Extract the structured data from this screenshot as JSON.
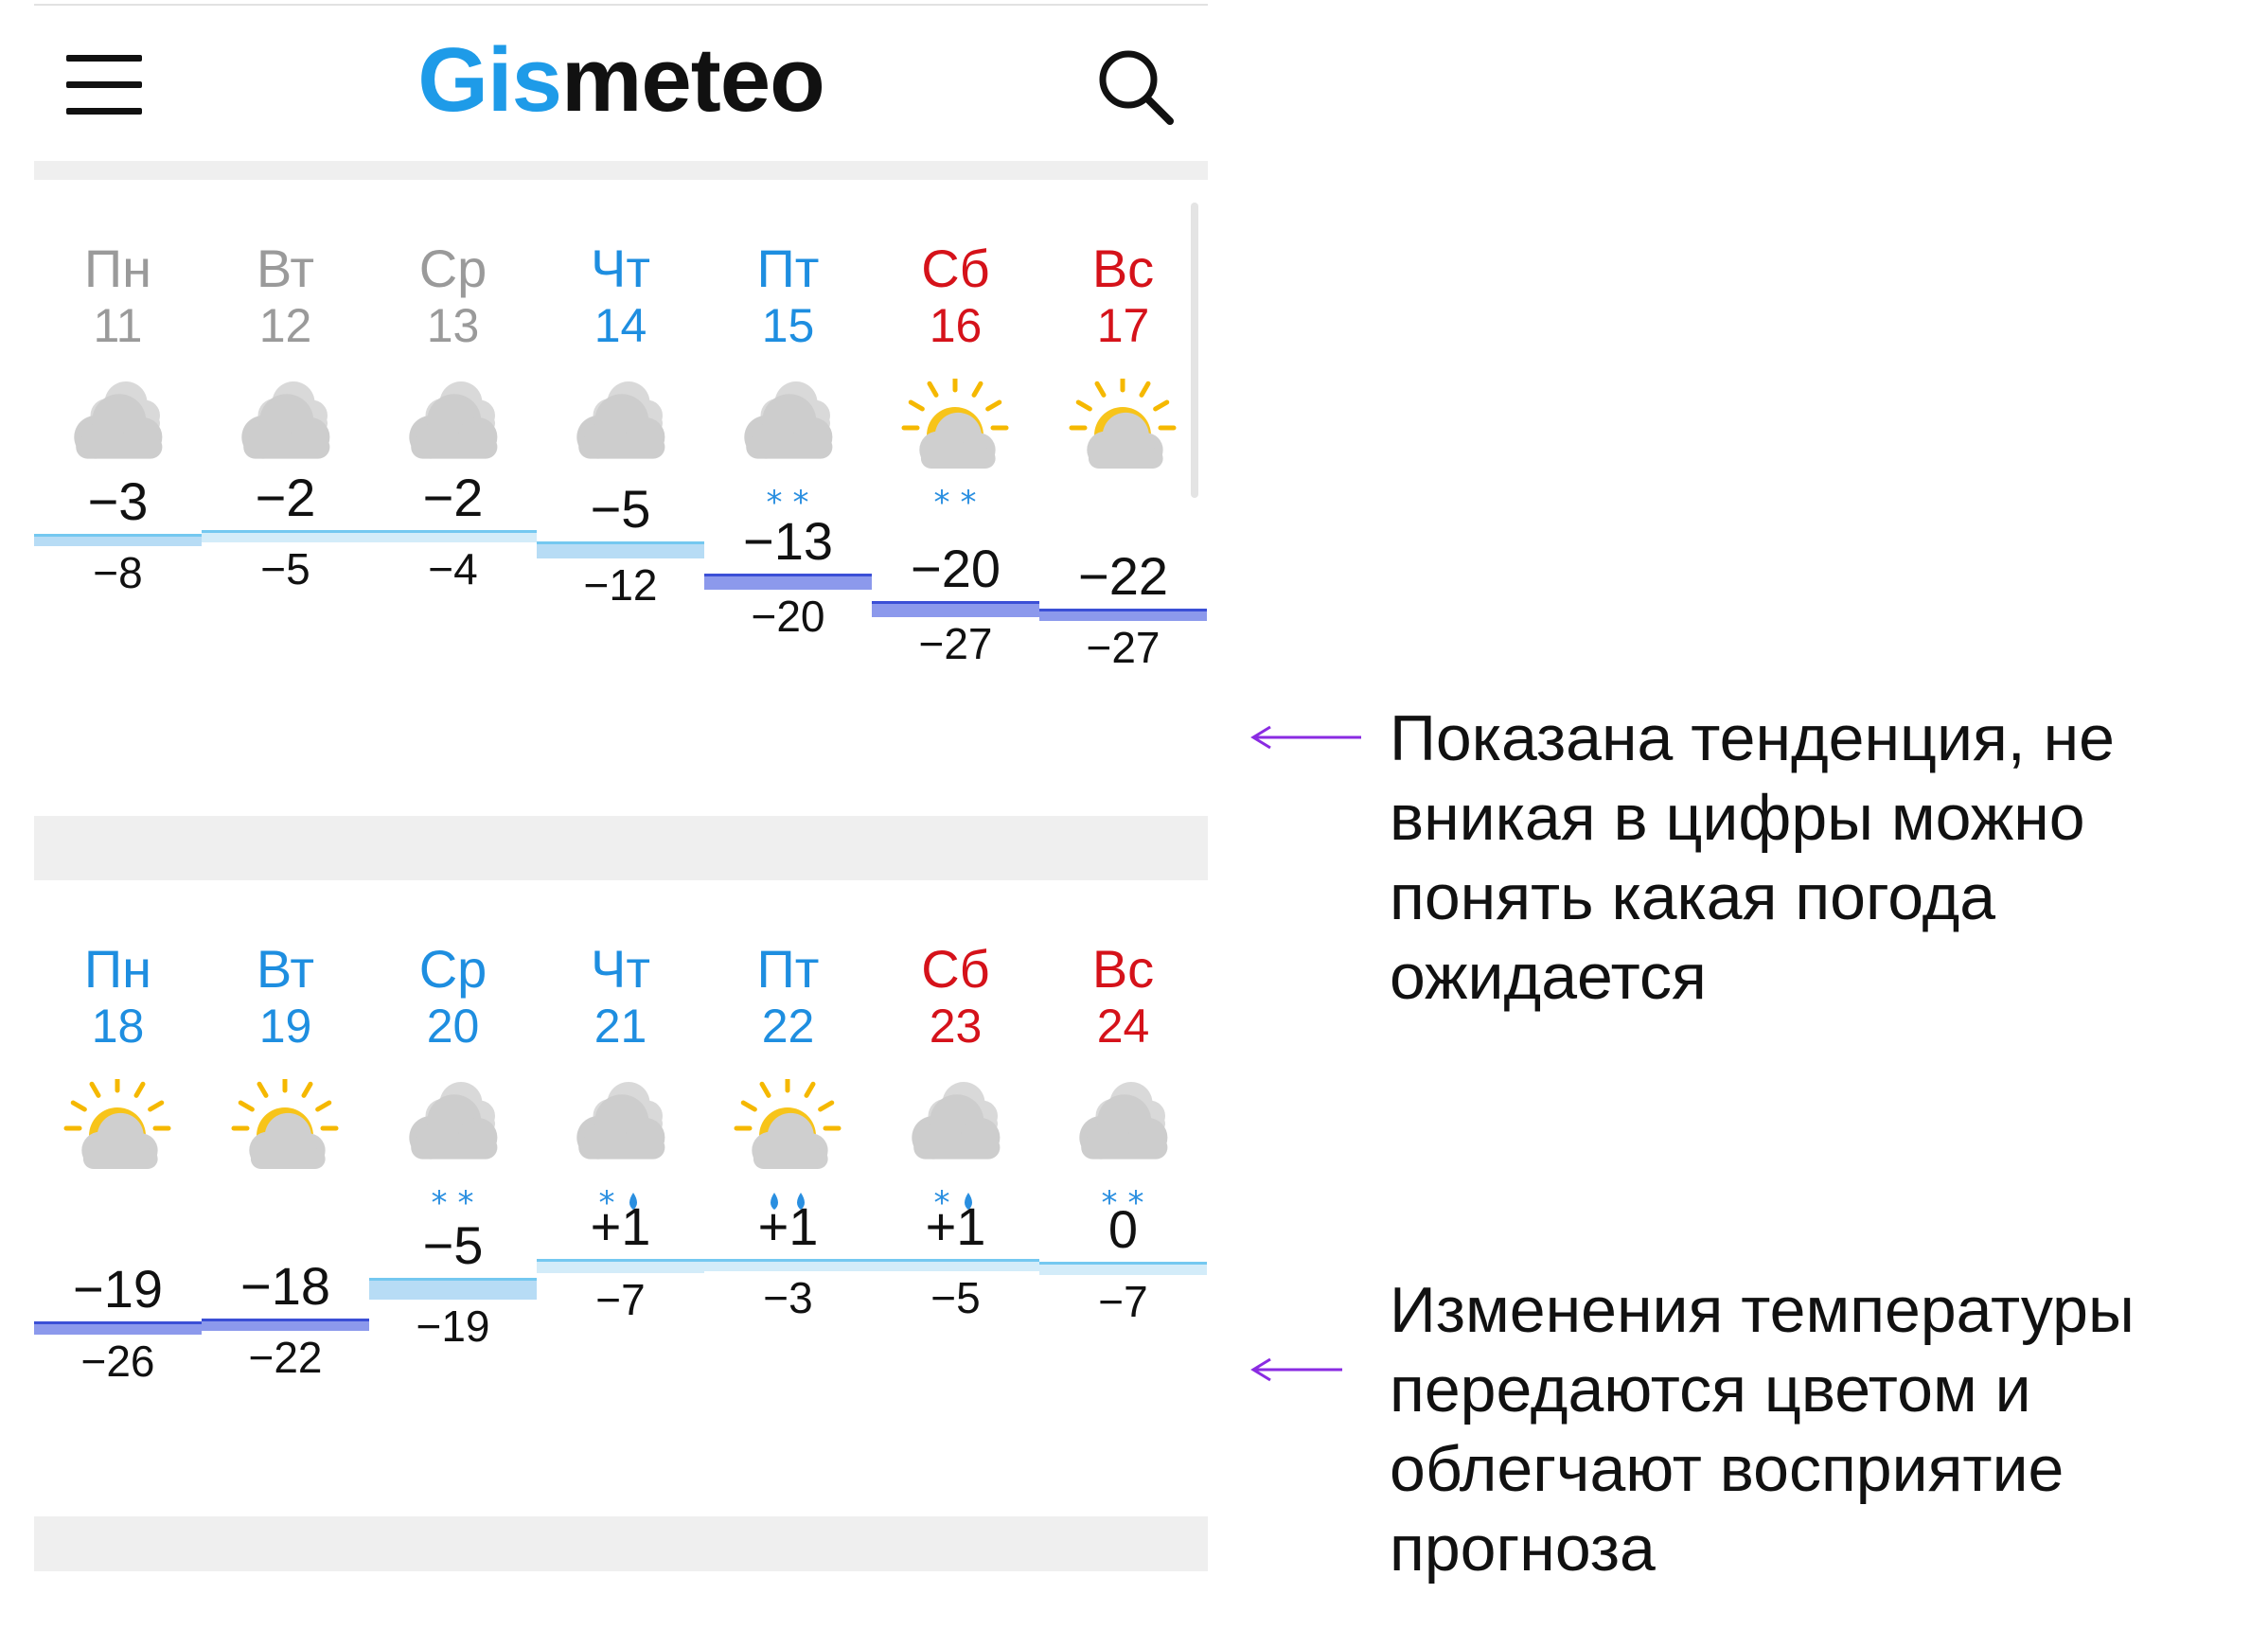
{
  "app": {
    "logo_part1": "Gis",
    "logo_part2": "meteo"
  },
  "header": {
    "menu_icon": "hamburger-menu-icon",
    "search_icon": "search-icon"
  },
  "weeks": [
    {
      "days": [
        {
          "name": "Пн",
          "date": "11",
          "type": "past",
          "icon": "cloudy",
          "precip": "none",
          "max": "−3",
          "min": "−8"
        },
        {
          "name": "Вт",
          "date": "12",
          "type": "past",
          "icon": "cloudy",
          "precip": "none",
          "max": "−2",
          "min": "−5"
        },
        {
          "name": "Ср",
          "date": "13",
          "type": "past",
          "icon": "cloudy",
          "precip": "none",
          "max": "−2",
          "min": "−4"
        },
        {
          "name": "Чт",
          "date": "14",
          "type": "weekday",
          "icon": "cloudy",
          "precip": "none",
          "max": "−5",
          "min": "−12"
        },
        {
          "name": "Пт",
          "date": "15",
          "type": "weekday",
          "icon": "cloudy",
          "precip": "snow",
          "max": "−13",
          "min": "−20"
        },
        {
          "name": "Сб",
          "date": "16",
          "type": "weekend",
          "icon": "partly-sunny",
          "precip": "snow",
          "max": "−20",
          "min": "−27"
        },
        {
          "name": "Вс",
          "date": "17",
          "type": "weekend",
          "icon": "partly-sunny",
          "precip": "none",
          "max": "−22",
          "min": "−27"
        }
      ]
    },
    {
      "days": [
        {
          "name": "Пн",
          "date": "18",
          "type": "weekday",
          "icon": "partly-sunny",
          "precip": "none",
          "max": "−19",
          "min": "−26"
        },
        {
          "name": "Вт",
          "date": "19",
          "type": "weekday",
          "icon": "partly-sunny",
          "precip": "none",
          "max": "−18",
          "min": "−22"
        },
        {
          "name": "Ср",
          "date": "20",
          "type": "weekday",
          "icon": "cloudy",
          "precip": "snow",
          "max": "−5",
          "min": "−19"
        },
        {
          "name": "Чт",
          "date": "21",
          "type": "weekday",
          "icon": "cloudy",
          "precip": "sleet",
          "max": "+1",
          "min": "−7"
        },
        {
          "name": "Пт",
          "date": "22",
          "type": "weekday",
          "icon": "partly-sunny",
          "precip": "rain",
          "max": "+1",
          "min": "−3"
        },
        {
          "name": "Сб",
          "date": "23",
          "type": "weekend",
          "icon": "cloudy",
          "precip": "sleet",
          "max": "+1",
          "min": "−5"
        },
        {
          "name": "Вс",
          "date": "24",
          "type": "weekend",
          "icon": "cloudy",
          "precip": "snow",
          "max": "0",
          "min": "−7"
        }
      ]
    }
  ],
  "annotations": [
    "Показана тенденция, не вникая в цифры можно понять какая погода ожидается",
    "Изменения температуры передаются цветом и облегчают восприятие прогноза"
  ],
  "colors": {
    "logo_blue": "#1e9be8",
    "weekday": "#1e8ee0",
    "weekend": "#d5121a",
    "past": "#9a9a9a",
    "arrow": "#8a2be2",
    "cold_band": "#8c99ec",
    "mild_band": "#b7dcf5",
    "warm_band": "#d6f3ea"
  }
}
